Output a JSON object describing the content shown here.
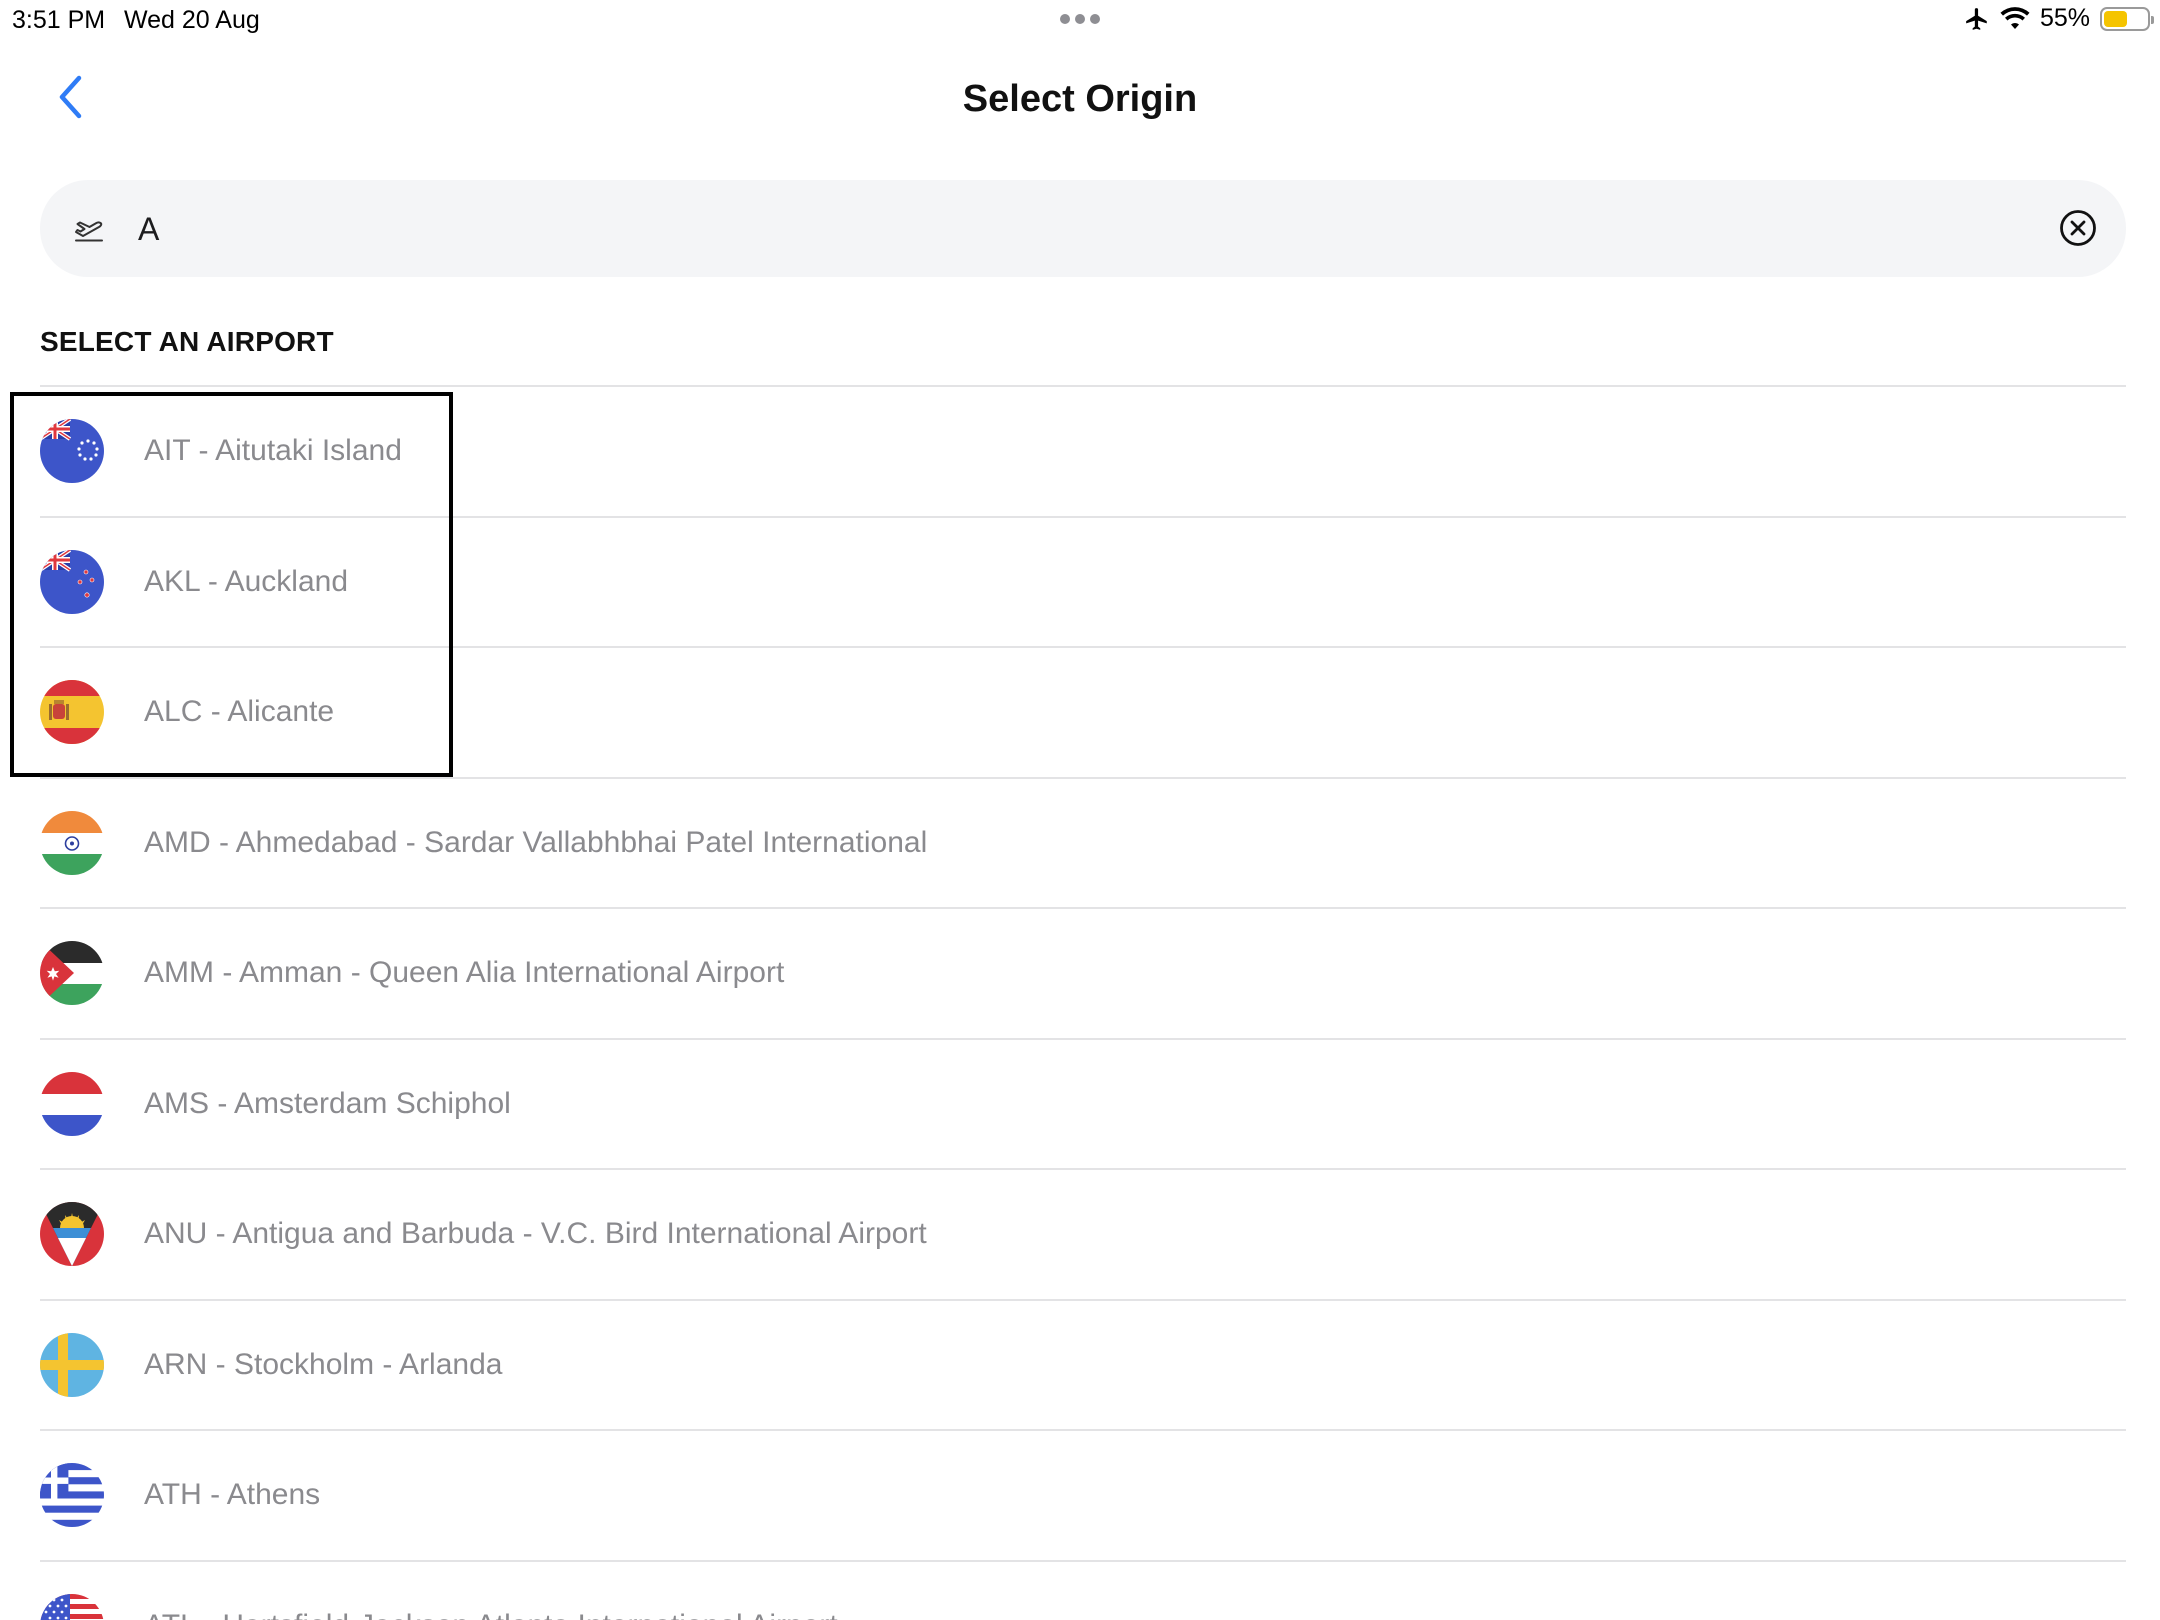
{
  "status_bar": {
    "time": "3:51 PM",
    "date": "Wed 20 Aug",
    "battery_percent": "55%",
    "battery_level": 0.55,
    "battery_color": "#f5c400"
  },
  "header": {
    "title": "Select Origin",
    "back_icon": "chevron-left-icon",
    "accent_color": "#2f7cf6"
  },
  "search": {
    "value": "A",
    "leading_icon": "plane-departure-icon",
    "clear_icon": "clear-circle-icon"
  },
  "list": {
    "heading": "SELECT AN AIRPORT",
    "items": [
      {
        "label": "AIT - Aitutaki Island",
        "flag": "cook-islands-flag"
      },
      {
        "label": "AKL - Auckland",
        "flag": "new-zealand-flag"
      },
      {
        "label": "ALC - Alicante",
        "flag": "spain-flag"
      },
      {
        "label": "AMD - Ahmedabad - Sardar Vallabhbhai Patel International",
        "flag": "india-flag"
      },
      {
        "label": "AMM - Amman - Queen Alia International Airport",
        "flag": "jordan-flag"
      },
      {
        "label": "AMS - Amsterdam Schiphol",
        "flag": "netherlands-flag"
      },
      {
        "label": "ANU - Antigua and Barbuda - V.C. Bird International Airport",
        "flag": "antigua-flag"
      },
      {
        "label": "ARN - Stockholm - Arlanda",
        "flag": "sweden-flag"
      },
      {
        "label": "ATH - Athens",
        "flag": "greece-flag"
      },
      {
        "label": "ATL - Hartsfield-Jackson Atlanta International Airport",
        "flag": "usa-flag"
      }
    ]
  }
}
